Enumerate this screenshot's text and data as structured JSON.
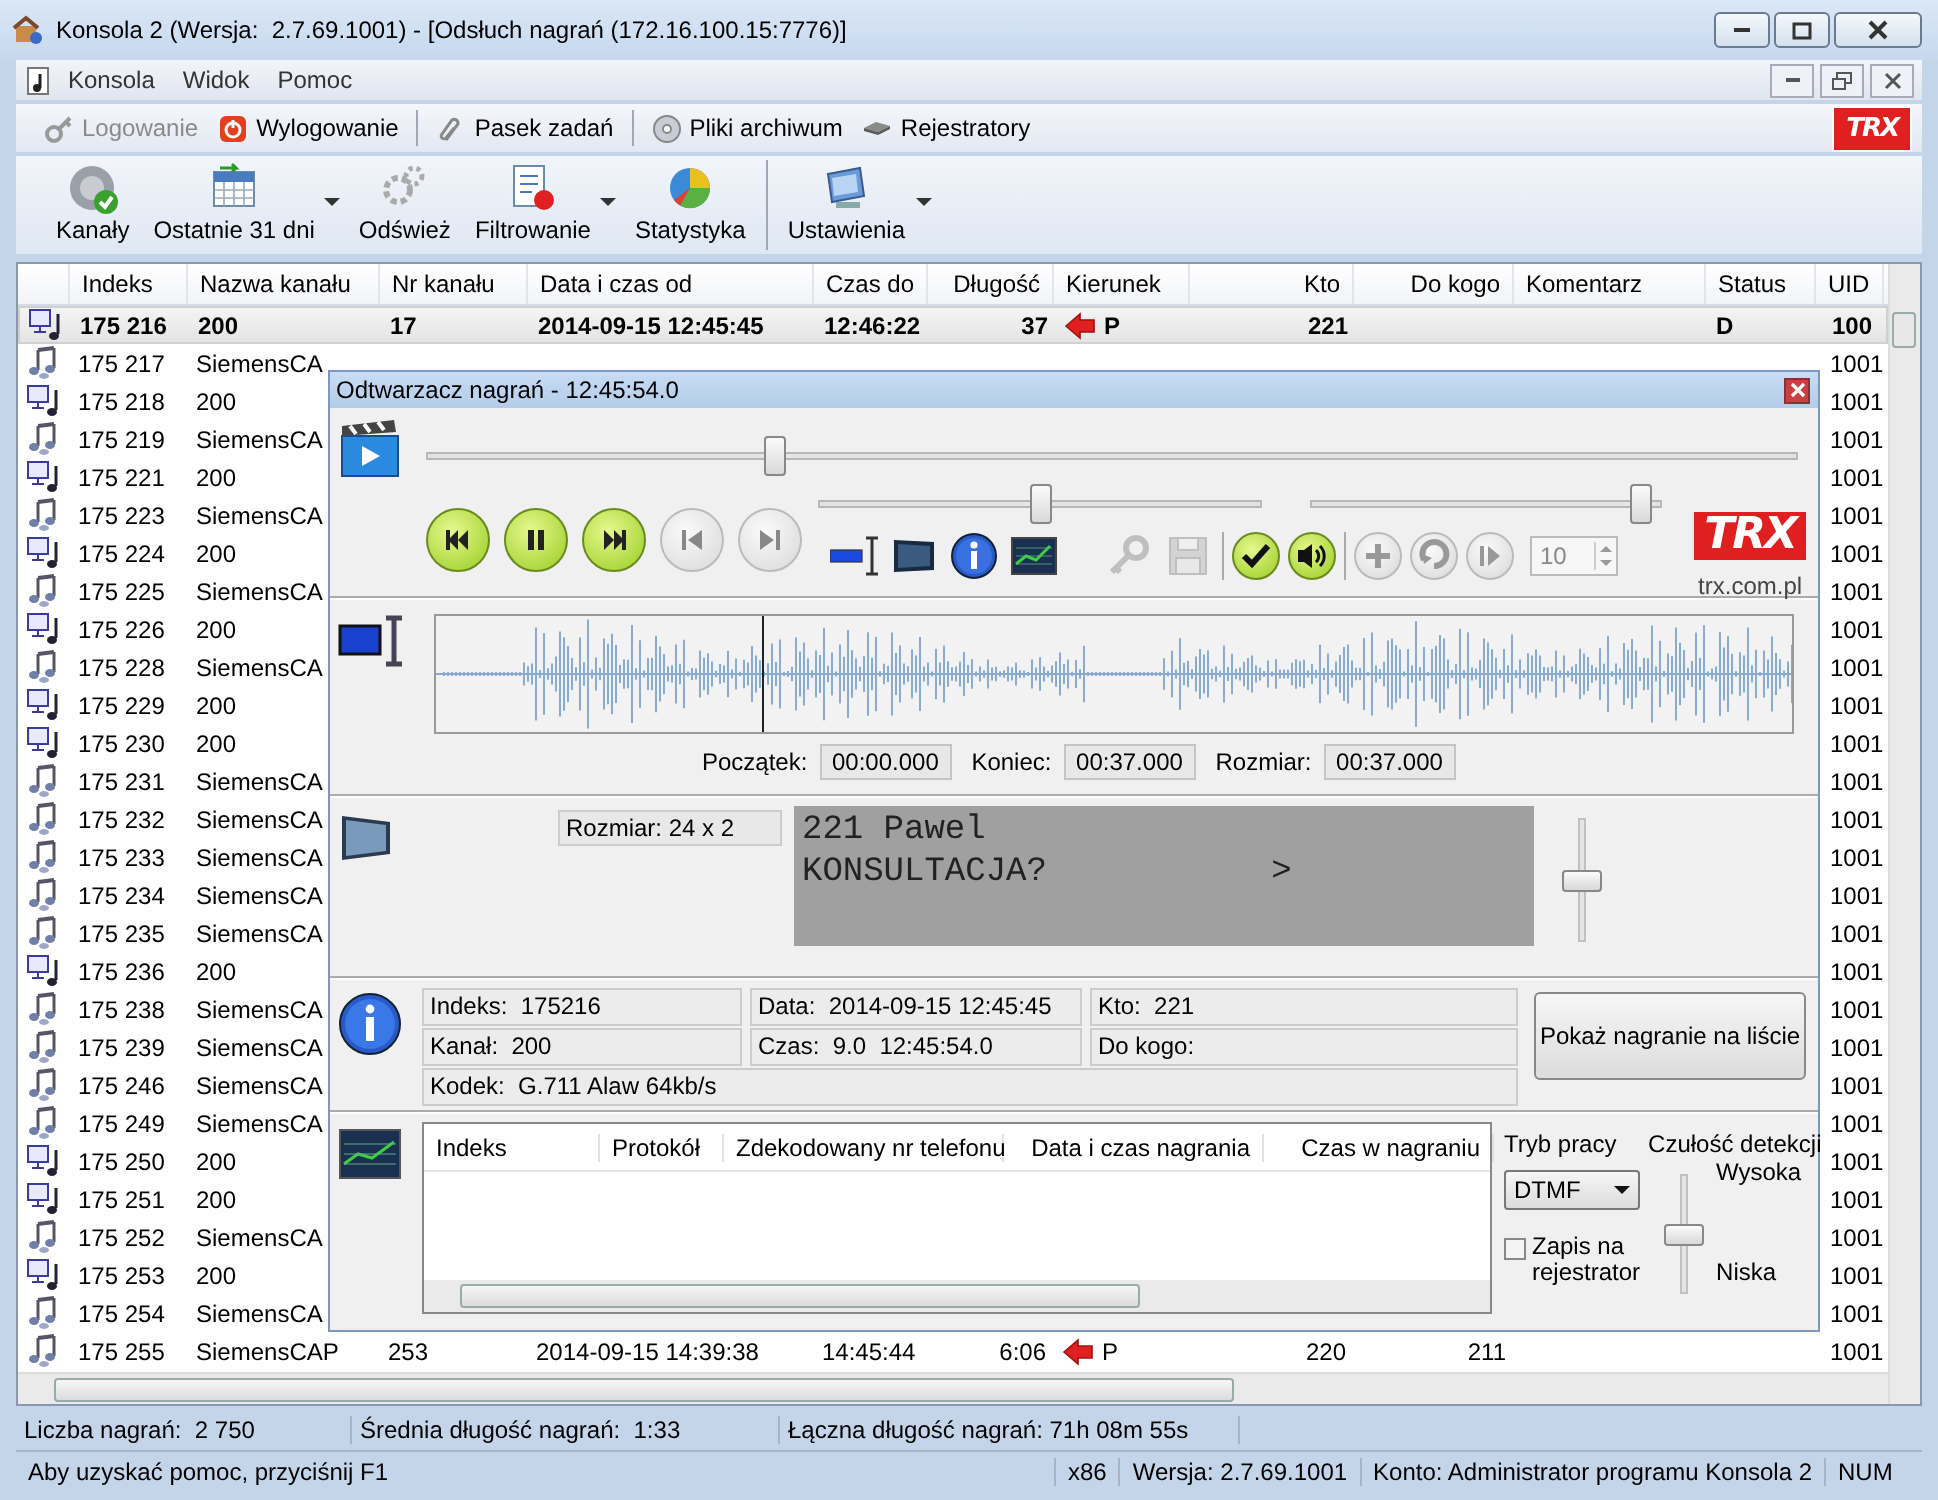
{
  "window": {
    "title": "Konsola 2 (Wersja:  2.7.69.1001) - [Odsłuch nagrań (172.16.100.15:7776)]",
    "logo": "TRX"
  },
  "menu": [
    "Konsola",
    "Widok",
    "Pomoc"
  ],
  "toolbar": [
    {
      "label": "Logowanie",
      "disabled": true
    },
    {
      "label": "Wylogowanie",
      "disabled": false
    },
    {
      "label": "Pasek zadań",
      "disabled": false
    },
    {
      "label": "Pliki archiwum",
      "disabled": false
    },
    {
      "label": "Rejestratory",
      "disabled": false
    }
  ],
  "ribbon": [
    {
      "label": "Kanały",
      "dropdown": false
    },
    {
      "label": "Ostatnie 31 dni",
      "dropdown": true
    },
    {
      "label": "Odśwież",
      "dropdown": false
    },
    {
      "label": "Filtrowanie",
      "dropdown": true
    },
    {
      "label": "Statystyka",
      "dropdown": false
    },
    {
      "label": "Ustawienia",
      "dropdown": true
    }
  ],
  "table": {
    "columns": [
      {
        "label": "Indeks",
        "kind": "text"
      },
      {
        "label": "Nazwa kanału",
        "kind": "text"
      },
      {
        "label": "Nr kanału",
        "kind": "text"
      },
      {
        "label": "Data i czas od",
        "kind": "text"
      },
      {
        "label": "Czas do",
        "kind": "text"
      },
      {
        "label": "Długość",
        "kind": "number"
      },
      {
        "label": "Kierunek",
        "kind": "direction"
      },
      {
        "label": "Kto",
        "kind": "number"
      },
      {
        "label": "Do kogo",
        "kind": "number"
      },
      {
        "label": "Komentarz",
        "kind": "text"
      },
      {
        "label": "Status",
        "kind": "text"
      },
      {
        "label": "UID",
        "kind": "text"
      }
    ],
    "rows": [
      {
        "kind": "pc",
        "selected": true,
        "cells": [
          "175 216",
          "200",
          "17",
          "2014-09-15 12:45:45",
          "12:46:22",
          "37",
          "P",
          "221",
          null,
          null,
          "D",
          "100"
        ]
      },
      {
        "kind": "notes",
        "selected": false,
        "cells": [
          "175 217",
          "SiemensCA",
          null,
          null,
          null,
          null,
          null,
          null,
          null,
          null,
          null,
          "1001"
        ]
      },
      {
        "kind": "pc",
        "selected": false,
        "cells": [
          "175 218",
          "200",
          null,
          null,
          null,
          null,
          null,
          null,
          null,
          null,
          null,
          "1001"
        ]
      },
      {
        "kind": "notes",
        "selected": false,
        "cells": [
          "175 219",
          "SiemensCA",
          null,
          null,
          null,
          null,
          null,
          null,
          null,
          null,
          null,
          "1001"
        ]
      },
      {
        "kind": "pc",
        "selected": false,
        "cells": [
          "175 221",
          "200",
          null,
          null,
          null,
          null,
          null,
          null,
          null,
          null,
          null,
          "1001"
        ]
      },
      {
        "kind": "notes",
        "selected": false,
        "cells": [
          "175 223",
          "SiemensCA",
          null,
          null,
          null,
          null,
          null,
          null,
          null,
          null,
          null,
          "1001"
        ]
      },
      {
        "kind": "pc",
        "selected": false,
        "cells": [
          "175 224",
          "200",
          null,
          null,
          null,
          null,
          null,
          null,
          null,
          null,
          null,
          "1001"
        ]
      },
      {
        "kind": "notes",
        "selected": false,
        "cells": [
          "175 225",
          "SiemensCA",
          null,
          null,
          null,
          null,
          null,
          null,
          null,
          null,
          null,
          "1001"
        ]
      },
      {
        "kind": "pc",
        "selected": false,
        "cells": [
          "175 226",
          "200",
          null,
          null,
          null,
          null,
          null,
          null,
          null,
          null,
          null,
          "1001"
        ]
      },
      {
        "kind": "notes",
        "selected": false,
        "cells": [
          "175 228",
          "SiemensCA",
          null,
          null,
          null,
          null,
          null,
          null,
          null,
          null,
          null,
          "1001"
        ]
      },
      {
        "kind": "pc",
        "selected": false,
        "cells": [
          "175 229",
          "200",
          null,
          null,
          null,
          null,
          null,
          null,
          null,
          null,
          null,
          "1001"
        ]
      },
      {
        "kind": "pc",
        "selected": false,
        "cells": [
          "175 230",
          "200",
          null,
          null,
          null,
          null,
          null,
          null,
          null,
          null,
          null,
          "1001"
        ]
      },
      {
        "kind": "notes",
        "selected": false,
        "cells": [
          "175 231",
          "SiemensCA",
          null,
          null,
          null,
          null,
          null,
          null,
          null,
          null,
          null,
          "1001"
        ]
      },
      {
        "kind": "notes",
        "selected": false,
        "cells": [
          "175 232",
          "SiemensCA",
          null,
          null,
          null,
          null,
          null,
          null,
          null,
          null,
          null,
          "1001"
        ]
      },
      {
        "kind": "notes",
        "selected": false,
        "cells": [
          "175 233",
          "SiemensCA",
          null,
          null,
          null,
          null,
          null,
          null,
          null,
          null,
          null,
          "1001"
        ]
      },
      {
        "kind": "notes",
        "selected": false,
        "cells": [
          "175 234",
          "SiemensCA",
          null,
          null,
          null,
          null,
          null,
          null,
          null,
          null,
          null,
          "1001"
        ]
      },
      {
        "kind": "notes",
        "selected": false,
        "cells": [
          "175 235",
          "SiemensCA",
          null,
          null,
          null,
          null,
          null,
          null,
          null,
          null,
          null,
          "1001"
        ]
      },
      {
        "kind": "pc",
        "selected": false,
        "cells": [
          "175 236",
          "200",
          null,
          null,
          null,
          null,
          null,
          null,
          null,
          null,
          null,
          "1001"
        ]
      },
      {
        "kind": "notes",
        "selected": false,
        "cells": [
          "175 238",
          "SiemensCA",
          null,
          null,
          null,
          null,
          null,
          null,
          null,
          null,
          null,
          "1001"
        ]
      },
      {
        "kind": "notes",
        "selected": false,
        "cells": [
          "175 239",
          "SiemensCA",
          null,
          null,
          null,
          null,
          null,
          null,
          null,
          null,
          null,
          "1001"
        ]
      },
      {
        "kind": "notes",
        "selected": false,
        "cells": [
          "175 246",
          "SiemensCA",
          null,
          null,
          null,
          null,
          null,
          null,
          null,
          null,
          null,
          "1001"
        ]
      },
      {
        "kind": "notes",
        "selected": false,
        "cells": [
          "175 249",
          "SiemensCA",
          null,
          null,
          null,
          null,
          null,
          null,
          null,
          null,
          null,
          "1001"
        ]
      },
      {
        "kind": "pc",
        "selected": false,
        "cells": [
          "175 250",
          "200",
          null,
          null,
          null,
          null,
          null,
          null,
          null,
          null,
          null,
          "1001"
        ]
      },
      {
        "kind": "pc",
        "selected": false,
        "cells": [
          "175 251",
          "200",
          null,
          null,
          null,
          null,
          null,
          null,
          null,
          null,
          null,
          "1001"
        ]
      },
      {
        "kind": "notes",
        "selected": false,
        "cells": [
          "175 252",
          "SiemensCA",
          null,
          null,
          null,
          null,
          null,
          null,
          null,
          null,
          null,
          "1001"
        ]
      },
      {
        "kind": "pc",
        "selected": false,
        "cells": [
          "175 253",
          "200",
          null,
          null,
          null,
          null,
          null,
          null,
          null,
          null,
          null,
          "1001"
        ]
      },
      {
        "kind": "notes",
        "selected": false,
        "cells": [
          "175 254",
          "SiemensCA",
          null,
          null,
          null,
          null,
          null,
          null,
          null,
          null,
          null,
          "1001"
        ]
      },
      {
        "kind": "notes",
        "selected": false,
        "cells": [
          "175 255",
          "SiemensCAP",
          "253",
          "2014-09-15 14:39:38",
          "14:45:44",
          "6:06",
          "P",
          "220",
          "211",
          null,
          null,
          "1001"
        ]
      }
    ]
  },
  "stats": [
    "Liczba nagrań:  2 750",
    "Średnia długość nagrań:  1:33",
    "Łączna długość nagrań: 71h 08m 55s"
  ],
  "status_bar": [
    "Aby uzyskać pomoc, przyciśnij F1",
    "x86",
    "Wersja: 2.7.69.1001",
    "Konto: Administrator programu Konsola 2",
    "NUM"
  ],
  "player": {
    "title": "Odtwarzacz nagrań - 12:45:54.0",
    "position": {
      "level": 0.25
    },
    "slider_a": {
      "level": 0.5
    },
    "slider_b": {
      "level": 0.97
    },
    "transport": [
      {
        "disabled": false
      },
      {
        "disabled": false
      },
      {
        "disabled": false
      },
      {
        "disabled": true
      },
      {
        "disabled": true
      }
    ],
    "actions": [
      {
        "disabled": true
      },
      {
        "disabled": true
      },
      {
        "disabled": false
      },
      {
        "disabled": false
      },
      {
        "disabled": true
      },
      {
        "disabled": true
      },
      {
        "disabled": true
      }
    ],
    "spin": {
      "value": "10",
      "disabled": true
    },
    "logo": "TRX",
    "site": "trx.com.pl",
    "waveform": {
      "cursor": {
        "level": 0.24
      },
      "start_label": "Początek:",
      "start": "00:00.000",
      "end_label": "Koniec:",
      "end": "00:37.000",
      "size_label": "Rozmiar:",
      "size": "00:37.000"
    },
    "display": {
      "size": "Rozmiar: 24 x 2",
      "lines": [
        "221 Pawel",
        "KONSULTACJA?           >"
      ],
      "slider": {
        "level": 0.5
      }
    },
    "info": {
      "fields": [
        "Indeks:  175216",
        "Data:  2014-09-15 12:45:45",
        "Kto:  221",
        "Kanał:  200",
        "Czas:  9.0  12:45:54.0",
        "Do kogo:",
        "Kodek:  G.711 Alaw 64kb/s"
      ],
      "button": "Pokaż nagranie na liście"
    },
    "dtmf": {
      "columns": [
        "Indeks",
        "Protokół",
        "Zdekodowany nr telefonu",
        "Data i czas nagrania",
        "Czas w nagraniu"
      ],
      "mode_label": "Tryb pracy",
      "mode": "DTMF",
      "save": {
        "label": "Zapis na rejestrator",
        "checked": false
      },
      "sensitivity": {
        "label": "Czułość detekcji",
        "high": "Wysoka",
        "low": "Niska",
        "level": 0.5
      }
    }
  }
}
